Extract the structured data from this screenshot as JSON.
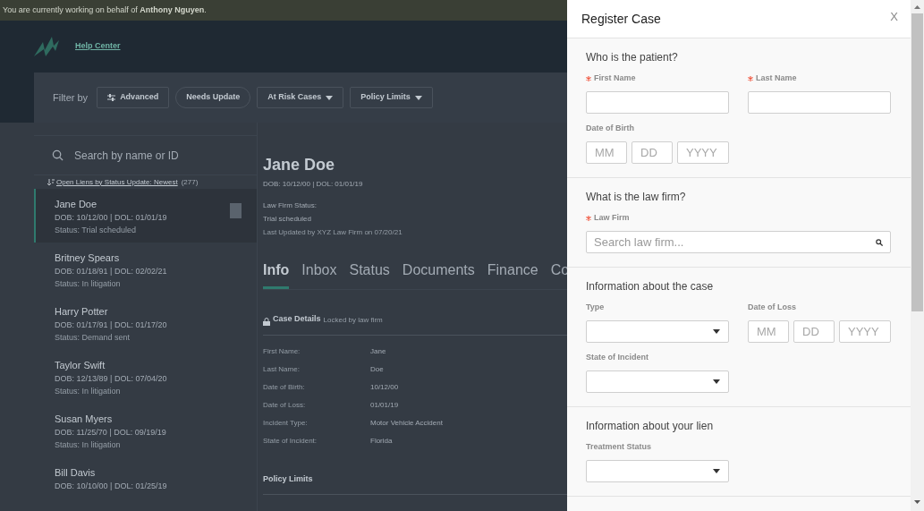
{
  "banner": {
    "text": "You are currently working on behalf of **Anthony Nguyen**."
  },
  "header": {
    "link": "Help Center"
  },
  "filters": {
    "label": "Filter by",
    "buttons": [
      {
        "label": "Advanced",
        "kind": "icon"
      },
      {
        "label": "Needs Update",
        "kind": "pill"
      },
      {
        "label": "At Risk Cases",
        "kind": "dropdown"
      },
      {
        "label": "Policy Limits",
        "kind": "dropdown"
      }
    ]
  },
  "list": {
    "search_placeholder": "Search by name or ID",
    "sort_link": "Open Liens by Status Update: Newest",
    "count": "(277)",
    "items": [
      {
        "name": "Jane Doe",
        "dates": "DOB: 10/12/00 | DOL: 01/01/19",
        "status": "Status: Trial scheduled",
        "selected": true
      },
      {
        "name": "Britney Spears",
        "dates": "DOB: 01/18/91 | DOL: 02/02/21",
        "status": "Status: In litigation",
        "selected": false
      },
      {
        "name": "Harry Potter",
        "dates": "DOB: 01/17/91 | DOL: 01/17/20",
        "status": "Status: Demand sent",
        "selected": false
      },
      {
        "name": "Taylor Swift",
        "dates": "DOB: 12/13/89 | DOL: 07/04/20",
        "status": "Status: In litigation",
        "selected": false
      },
      {
        "name": "Susan Myers",
        "dates": "DOB: 11/25/70 | DOL: 09/19/19",
        "status": "Status: In litigation",
        "selected": false
      },
      {
        "name": "Bill Davis",
        "dates": "DOB: 10/10/00 | DOL: 01/25/19",
        "selected": false
      }
    ]
  },
  "detail": {
    "name": "Jane Doe",
    "dates": "DOB: 10/12/00 | DOL: 01/01/19",
    "status_label": "Law Firm Status:",
    "status": "Trial scheduled",
    "updated": "Last Updated by XYZ Law Firm on 07/20/21",
    "tabs": [
      {
        "label": "Info",
        "selected": true
      },
      {
        "label": "Inbox",
        "selected": false
      },
      {
        "label": "Status",
        "selected": false
      },
      {
        "label": "Documents",
        "selected": false
      },
      {
        "label": "Finance",
        "selected": false
      },
      {
        "label": "Co",
        "selected": false
      }
    ],
    "case_details": {
      "title": "Case Details",
      "note": "Locked by law firm",
      "fields": [
        {
          "label": "First Name:",
          "value": "Jane"
        },
        {
          "label": "Last Name:",
          "value": "Doe"
        },
        {
          "label": "Date of Birth:",
          "value": "10/12/00"
        },
        {
          "label": "Date of Loss:",
          "value": "01/01/19"
        },
        {
          "label": "Incident Type:",
          "value": "Motor Vehicle Accident"
        },
        {
          "label": "State of Incident:",
          "value": "Florida"
        }
      ]
    },
    "policy_limits": {
      "title": "Policy Limits"
    }
  },
  "modal": {
    "title": "Register Case",
    "close": "X",
    "sections": [
      {
        "heading": "Who is the patient?",
        "rows": [
          [
            {
              "label": "First Name",
              "required": true,
              "kind": "text"
            },
            {
              "label": "Last Name",
              "required": true,
              "kind": "text"
            }
          ],
          [
            {
              "label": "Date of Birth",
              "required": false,
              "kind": "date",
              "placeholders": [
                "MM",
                "DD",
                "YYYY"
              ]
            }
          ]
        ]
      },
      {
        "heading": "What is the law firm?",
        "rows": [
          [
            {
              "label": "Law Firm",
              "required": true,
              "kind": "search",
              "placeholder": "Search law firm..."
            }
          ]
        ]
      },
      {
        "heading": "Information about the case",
        "rows": [
          [
            {
              "label": "Type",
              "required": false,
              "kind": "select"
            },
            {
              "label": "Date of Loss",
              "required": false,
              "kind": "date",
              "placeholders": [
                "MM",
                "DD",
                "YYYY"
              ]
            }
          ],
          [
            {
              "label": "State of Incident",
              "required": false,
              "kind": "select"
            }
          ]
        ]
      },
      {
        "heading": "Information about your lien",
        "rows": [
          [
            {
              "label": "Treatment Status",
              "required": false,
              "kind": "select"
            }
          ]
        ]
      }
    ]
  }
}
